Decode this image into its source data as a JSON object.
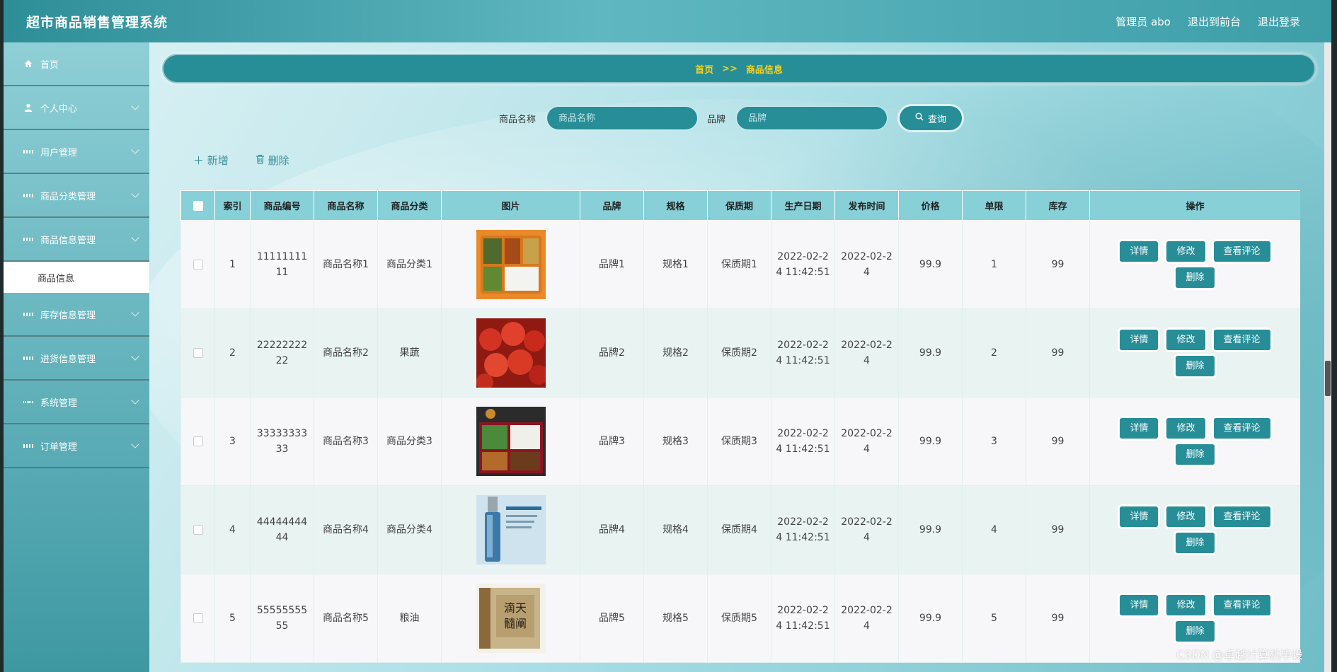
{
  "header": {
    "title": "超市商品销售管理系统",
    "user_label": "管理员 abo",
    "to_frontend": "退出到前台",
    "logout": "退出登录"
  },
  "sidebar": {
    "items": [
      {
        "label": "首页",
        "icon": "home-icon"
      },
      {
        "label": "个人中心",
        "icon": "user-icon"
      },
      {
        "label": "用户管理",
        "icon": "grid-icon"
      },
      {
        "label": "商品分类管理",
        "icon": "grid-icon"
      },
      {
        "label": "商品信息管理",
        "icon": "grid-icon"
      },
      {
        "label": "库存信息管理",
        "icon": "grid-icon"
      },
      {
        "label": "进货信息管理",
        "icon": "grid-icon"
      },
      {
        "label": "系统管理",
        "icon": "grid9-icon"
      },
      {
        "label": "订单管理",
        "icon": "grid-icon"
      }
    ],
    "submenu_active": "商品信息"
  },
  "breadcrumb": {
    "home": "首页",
    "sep": ">>",
    "current": "商品信息"
  },
  "search": {
    "name_label": "商品名称",
    "name_placeholder": "商品名称",
    "brand_label": "品牌",
    "brand_placeholder": "品牌",
    "button": "查询"
  },
  "actions": {
    "add": "新增",
    "delete": "删除"
  },
  "table": {
    "headers": [
      "索引",
      "商品编号",
      "商品名称",
      "商品分类",
      "图片",
      "品牌",
      "规格",
      "保质期",
      "生产日期",
      "发布时间",
      "价格",
      "单限",
      "库存",
      "操作"
    ],
    "rows": [
      {
        "index": "1",
        "code": "1111111111",
        "name": "商品名称1",
        "category": "商品分类1",
        "image": "bento-box",
        "brand": "品牌1",
        "spec": "规格1",
        "shelf": "保质期1",
        "prod_date": "2022-02-24 11:42:51",
        "pub_date": "2022-02-24",
        "price": "99.9",
        "limit": "1",
        "stock": "99"
      },
      {
        "index": "2",
        "code": "2222222222",
        "name": "商品名称2",
        "category": "果蔬",
        "image": "cherries",
        "brand": "品牌2",
        "spec": "规格2",
        "shelf": "保质期2",
        "prod_date": "2022-02-24 11:42:51",
        "pub_date": "2022-02-24",
        "price": "99.9",
        "limit": "2",
        "stock": "99"
      },
      {
        "index": "3",
        "code": "3333333333",
        "name": "商品名称3",
        "category": "商品分类3",
        "image": "meal-tray",
        "brand": "品牌3",
        "spec": "规格3",
        "shelf": "保质期3",
        "prod_date": "2022-02-24 11:42:51",
        "pub_date": "2022-02-24",
        "price": "99.9",
        "limit": "3",
        "stock": "99"
      },
      {
        "index": "4",
        "code": "4444444444",
        "name": "商品名称4",
        "category": "商品分类4",
        "image": "serum-bottle",
        "brand": "品牌4",
        "spec": "规格4",
        "shelf": "保质期4",
        "prod_date": "2022-02-24 11:42:51",
        "pub_date": "2022-02-24",
        "price": "99.9",
        "limit": "4",
        "stock": "99"
      },
      {
        "index": "5",
        "code": "5555555555",
        "name": "商品名称5",
        "category": "粮油",
        "image": "book",
        "brand": "品牌5",
        "spec": "规格5",
        "shelf": "保质期5",
        "prod_date": "2022-02-24 11:42:51",
        "pub_date": "2022-02-24",
        "price": "99.9",
        "limit": "5",
        "stock": "99"
      }
    ],
    "ops": {
      "detail": "详情",
      "edit": "修改",
      "comments": "查看评论",
      "delete": "删除"
    }
  },
  "watermark": "CSDN @卓越计算机毕设",
  "colors": {
    "primary": "#278e98",
    "header_bg": "#87d0d8",
    "breadcrumb_text": "#f7d31c"
  }
}
